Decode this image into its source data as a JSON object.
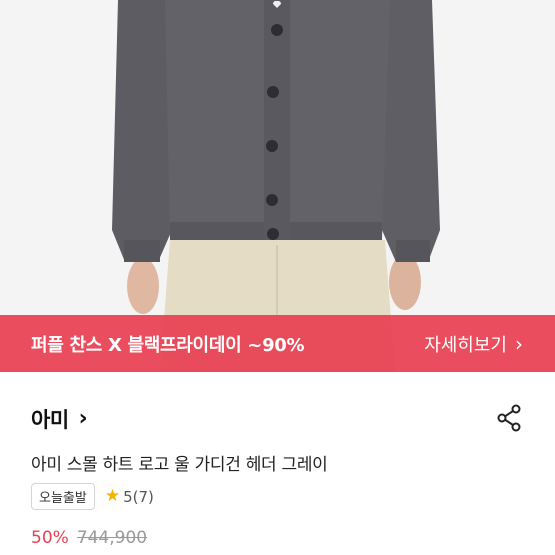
{
  "product_image": {
    "alt_icon": "cardigan-photo"
  },
  "promo_banner": {
    "text": "퍼플 찬스 X 블랙프라이데이 ~90%",
    "link_label": "자세히보기",
    "link_icon": "chevron-right-icon",
    "color": "#e84152"
  },
  "product": {
    "brand": "아미",
    "brand_icon": "chevron-right-icon",
    "title": "아미 스몰 하트 로고 울 가디건 헤더 그레이",
    "badge": "오늘출발",
    "rating": "5(7)",
    "rating_icon": "star-icon",
    "discount": "50%",
    "original_price": "744,900",
    "share_icon": "share-icon"
  }
}
